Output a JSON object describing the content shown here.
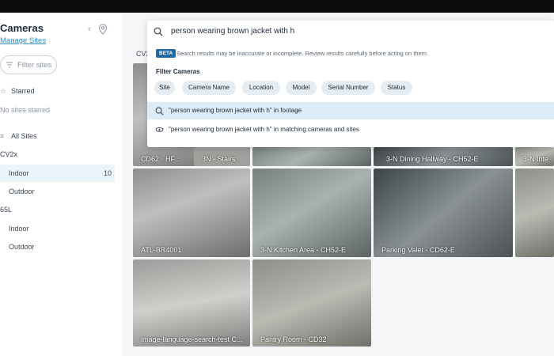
{
  "sidebar": {
    "title": "Cameras",
    "manage_link": "Manage Sites",
    "filter_placeholder": "Filter sites",
    "starred_heading": "Starred",
    "no_starred": "No sites starred",
    "all_sites_heading": "All Sites",
    "groups": [
      {
        "name": "CV2x",
        "children": [
          {
            "label": "Indoor",
            "count": "10",
            "selected": true
          },
          {
            "label": "Outdoor",
            "count": ""
          }
        ]
      },
      {
        "name": "65L",
        "children": [
          {
            "label": "Indoor",
            "count": ""
          },
          {
            "label": "Outdoor",
            "count": ""
          }
        ]
      }
    ]
  },
  "main": {
    "section_label": "CV2",
    "tiles_row1_captions": [
      "CD62 · HF...",
      "3N - Stairs",
      "3-N Dining Hallway - CH52-E",
      "3-N Inte"
    ],
    "tiles": [
      {
        "caption": "ATL-BR4001"
      },
      {
        "caption": "3-N Kitchen Area - CH52-E"
      },
      {
        "caption": "Parking Valet - CD62-E"
      },
      {
        "caption": "image-language-search-test C..."
      },
      {
        "caption": "Pantry Room - CD32"
      }
    ]
  },
  "search": {
    "query": "person wearing brown jacket with h",
    "beta_badge": "BETA",
    "beta_notice": "Search results may be inaccurate or incomplete. Review results carefully before acting on them.",
    "filter_title": "Filter Cameras",
    "filters": [
      "Site",
      "Camera Name",
      "Location",
      "Model",
      "Serial Number",
      "Status"
    ],
    "suggestions": [
      {
        "text": "\"person wearing brown jacket with h\" in footage",
        "icon": "search-icon"
      },
      {
        "text": "\"person wearing brown jacket with h\" in matching cameras and sites",
        "icon": "camera-icon"
      }
    ]
  },
  "colors": {
    "accent": "#2d8bc9",
    "selected_bg": "#eaf4fb",
    "beta": "#1f6aa5",
    "highlight": "#dcecf7"
  }
}
